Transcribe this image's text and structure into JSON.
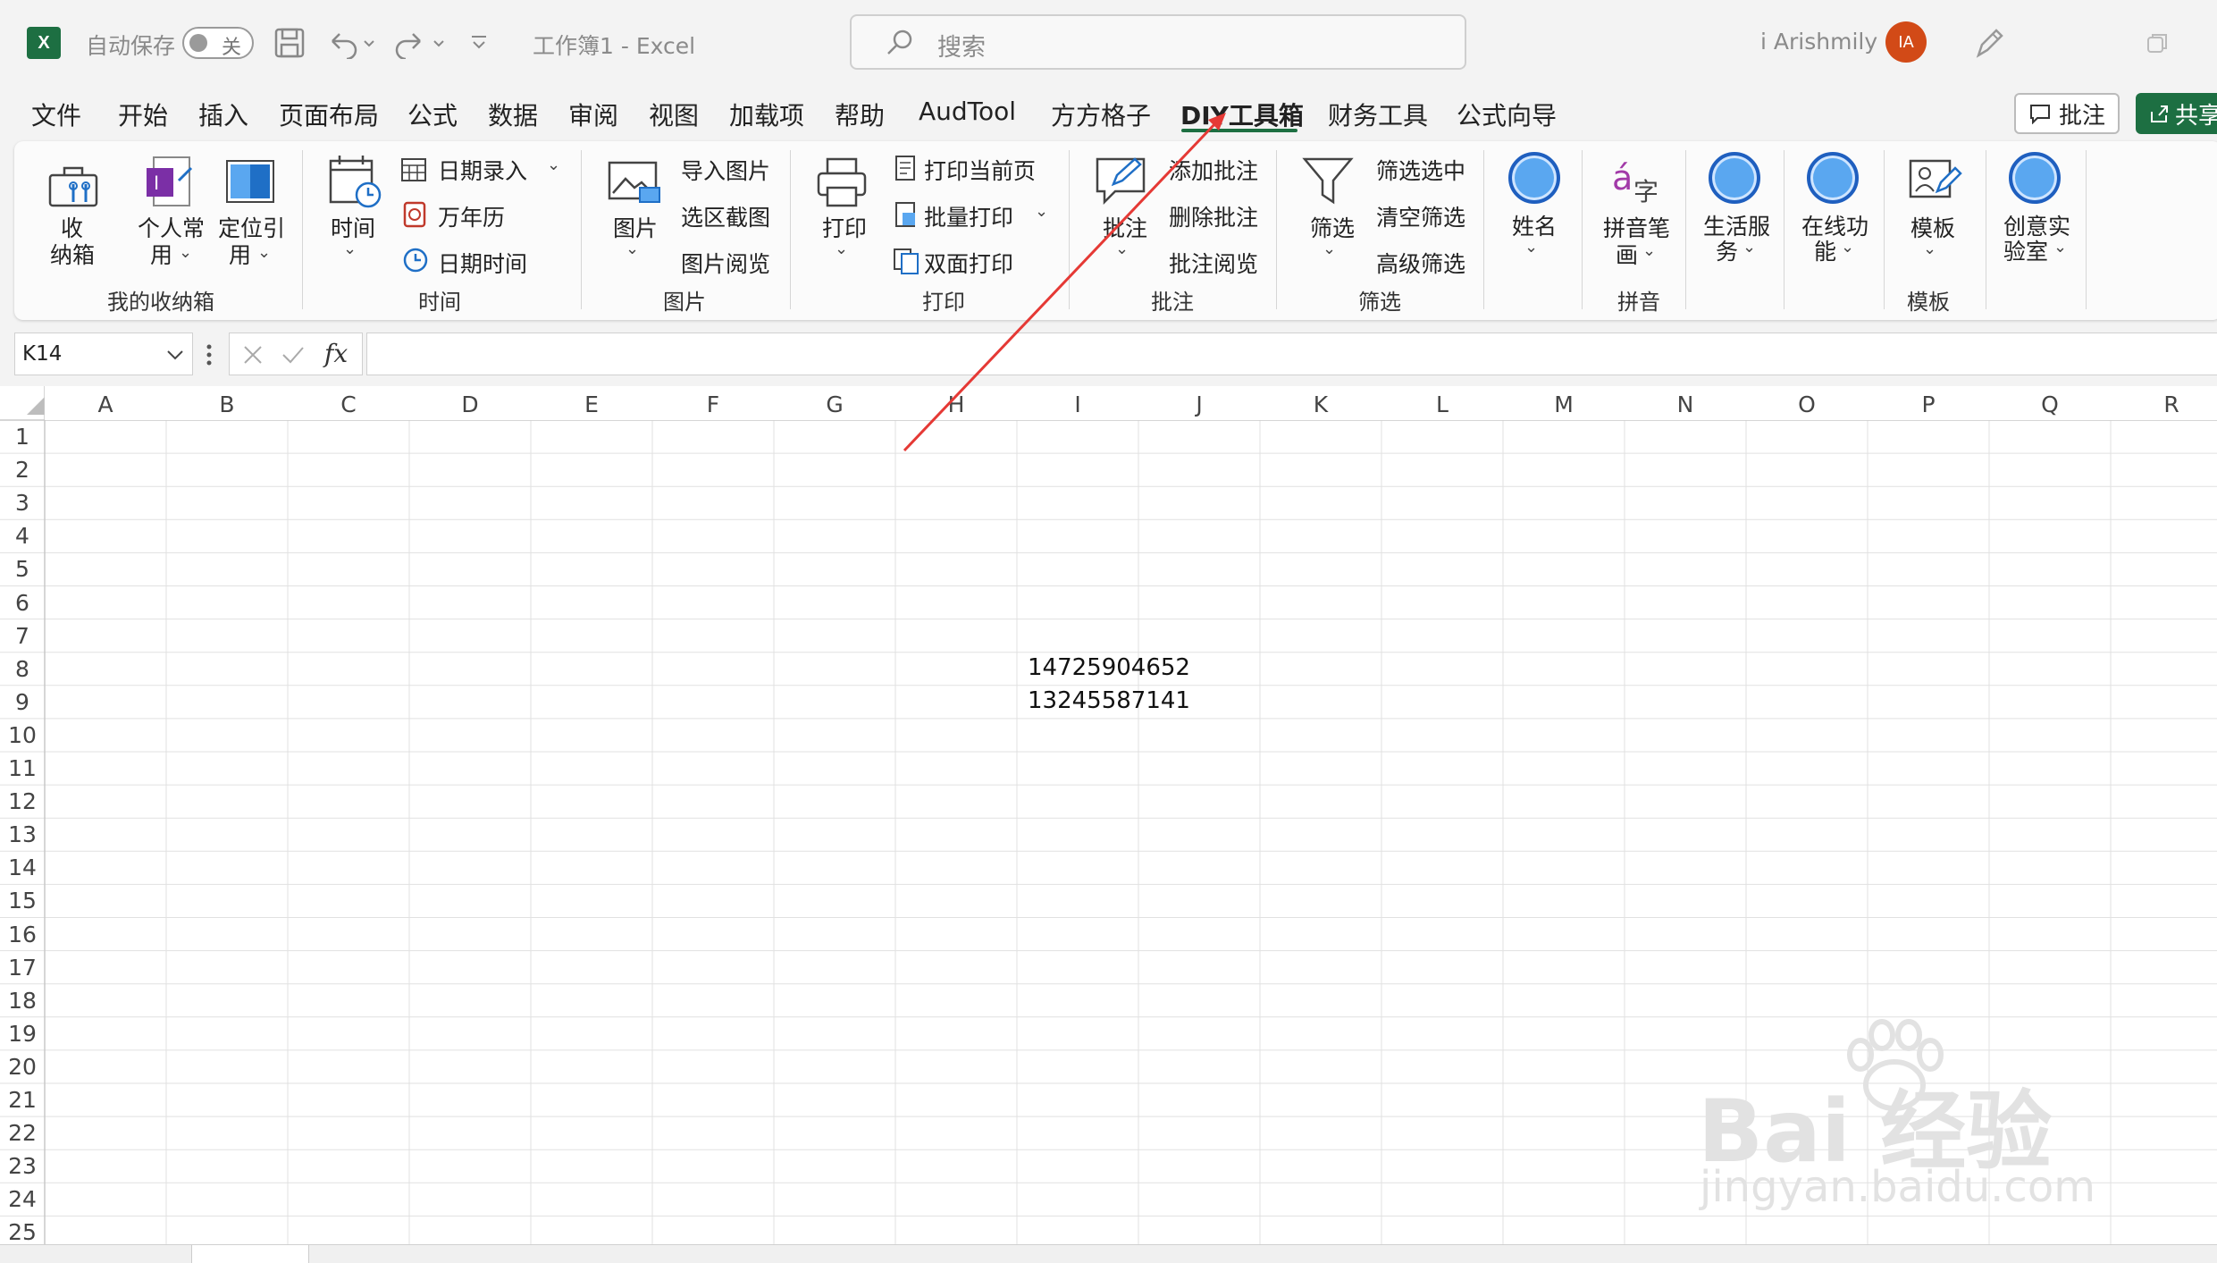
{
  "titlebar": {
    "autosave_label": "自动保存",
    "autosave_state": "关",
    "doc_title": "工作簿1  -  Excel",
    "search_placeholder": "搜索",
    "user_name": "i Arishmily",
    "user_initials": "IA"
  },
  "tabs": [
    "文件",
    "开始",
    "插入",
    "页面布局",
    "公式",
    "数据",
    "审阅",
    "视图",
    "加载项",
    "帮助",
    "AudTool",
    "方方格子",
    "DIY工具箱",
    "财务工具",
    "公式向导"
  ],
  "active_tab": "DIY工具箱",
  "actions": {
    "comment": "批注",
    "share": "共享"
  },
  "ribbon": {
    "storage": {
      "big1_a": "收",
      "big1_b": "纳箱",
      "big2_a": "个人常",
      "big2_b": "用",
      "big3_a": "定位引",
      "big3_b": "用",
      "group": "我的收纳箱"
    },
    "time": {
      "big": "时间",
      "item1": "日期录入",
      "item2": "万年历",
      "item3": "日期时间",
      "group": "时间"
    },
    "picture": {
      "big": "图片",
      "item1": "导入图片",
      "item2": "选区截图",
      "item3": "图片阅览",
      "group": "图片"
    },
    "print": {
      "big": "打印",
      "item1": "打印当前页",
      "item2": "批量打印",
      "item3": "双面打印",
      "group": "打印"
    },
    "comment": {
      "big": "批注",
      "item1": "添加批注",
      "item2": "删除批注",
      "item3": "批注阅览",
      "group": "批注"
    },
    "filter": {
      "big": "筛选",
      "item1": "筛选选中",
      "item2": "清空筛选",
      "item3": "高级筛选",
      "group": "筛选"
    },
    "name": {
      "big": "姓名"
    },
    "pinyin": {
      "big_a": "拼音笔",
      "big_b": "画",
      "group": "拼音"
    },
    "life": {
      "big_a": "生活服",
      "big_b": "务"
    },
    "online": {
      "big_a": "在线功",
      "big_b": "能"
    },
    "template": {
      "big": "模板",
      "group": "模板"
    },
    "lab": {
      "big_a": "创意实",
      "big_b": "验室"
    }
  },
  "formula_bar": {
    "name_box": "K14",
    "fx": "fx",
    "formula": ""
  },
  "columns": [
    "A",
    "B",
    "C",
    "D",
    "E",
    "F",
    "G",
    "H",
    "I",
    "J",
    "K",
    "L",
    "M",
    "N",
    "O",
    "P",
    "Q",
    "R"
  ],
  "rows": [
    "1",
    "2",
    "3",
    "4",
    "5",
    "6",
    "7",
    "8",
    "9",
    "10",
    "11",
    "12",
    "13",
    "14",
    "15",
    "16",
    "17",
    "18",
    "19",
    "20",
    "21",
    "22",
    "23",
    "24",
    "25"
  ],
  "cells": [
    {
      "ref": "I8",
      "value": "14725904652"
    },
    {
      "ref": "I9",
      "value": "13245587141"
    }
  ],
  "watermark": {
    "main": "Bai 经验",
    "sub": "jingyan.baidu.com"
  },
  "colors": {
    "excel_green": "#1d6f42",
    "annotation_arrow": "#e53935",
    "avatar": "#d24a17"
  }
}
